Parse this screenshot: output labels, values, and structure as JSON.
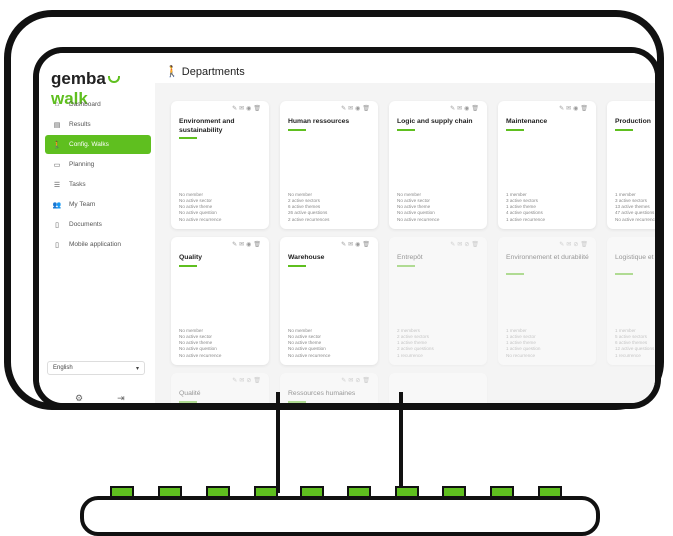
{
  "logo": {
    "part1": "gemba",
    "part2": "walk"
  },
  "header": {
    "title": "Departments",
    "icon": "walker-icon"
  },
  "sidebar": {
    "items": [
      {
        "label": "Dashboard",
        "icon": "home-icon"
      },
      {
        "label": "Results",
        "icon": "document-icon"
      },
      {
        "label": "Config. Walks",
        "icon": "walker-icon",
        "active": true
      },
      {
        "label": "Planning",
        "icon": "calendar-icon"
      },
      {
        "label": "Tasks",
        "icon": "list-icon"
      },
      {
        "label": "My Team",
        "icon": "team-icon"
      },
      {
        "label": "Documents",
        "icon": "file-icon"
      },
      {
        "label": "Mobile application",
        "icon": "phone-icon"
      }
    ],
    "language": "English"
  },
  "cards": [
    {
      "title": "Environment and sustainability",
      "stats": [
        "No member",
        "No active sector",
        "No active theme",
        "No active question",
        "No active recurrence"
      ],
      "faded": false
    },
    {
      "title": "Human ressources",
      "stats": [
        "No member",
        "2 active sectors",
        "6 active themes",
        "26 active questions",
        "2 active recurrences"
      ],
      "faded": false
    },
    {
      "title": "Logic and supply chain",
      "stats": [
        "No member",
        "No active sector",
        "No active theme",
        "No active question",
        "No active recurrence"
      ],
      "faded": false
    },
    {
      "title": "Maintenance",
      "stats": [
        "1 member",
        "3 active sectors",
        "1 active theme",
        "4 active questions",
        "1 active recurrence"
      ],
      "faded": false
    },
    {
      "title": "Production",
      "stats": [
        "1 member",
        "3 active sectors",
        "13 active themes",
        "47 active questions",
        "No active recurrence"
      ],
      "faded": false
    },
    {
      "title": "Quality",
      "stats": [
        "No member",
        "No active sector",
        "No active theme",
        "No active question",
        "No active recurrence"
      ],
      "faded": false
    },
    {
      "title": "Warehouse",
      "stats": [
        "No member",
        "No active sector",
        "No active theme",
        "No active question",
        "No active recurrence"
      ],
      "faded": false
    },
    {
      "title": "Entrepôt",
      "stats": [
        "2 members",
        "2 active sectors",
        "1 active theme",
        "2 active questions",
        "1 recurrence"
      ],
      "faded": true
    },
    {
      "title": "Environnement et durabilité",
      "stats": [
        "1 member",
        "1 active sector",
        "1 active theme",
        "1 active question",
        "No recurrence"
      ],
      "faded": true
    },
    {
      "title": "Logistique et d'approvision",
      "stats": [
        "1 member",
        "5 active sectors",
        "6 active themes",
        "12 active questions",
        "1 recurrence"
      ],
      "faded": true
    },
    {
      "title": "Qualité",
      "stats": [],
      "faded": true
    },
    {
      "title": "Ressources humaines",
      "stats": [],
      "faded": true
    },
    {
      "title": "",
      "stats": [],
      "faded": true
    }
  ],
  "colors": {
    "accent": "#5fbf1f",
    "background": "#f4f4f4"
  }
}
